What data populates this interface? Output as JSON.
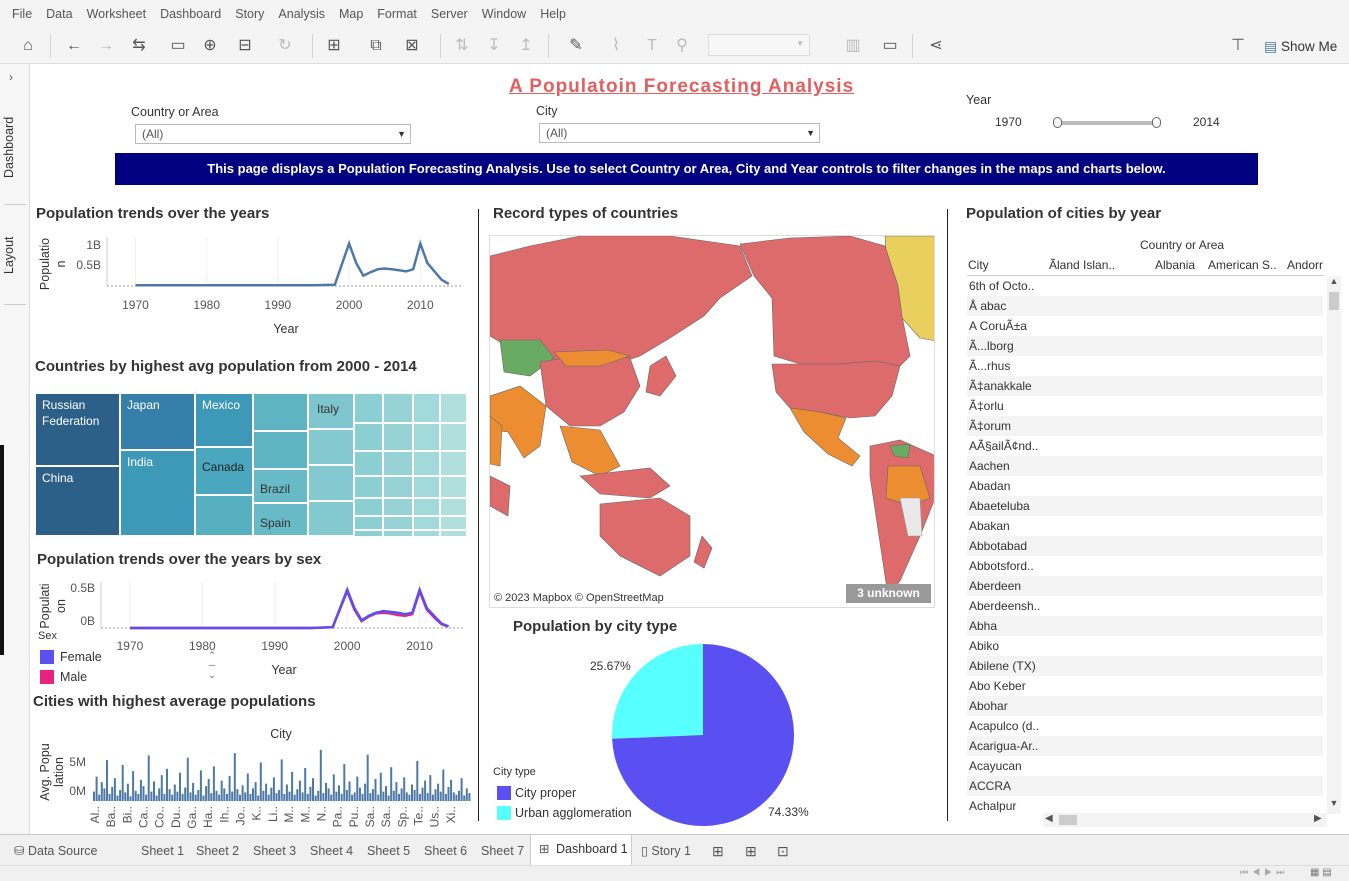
{
  "menu": [
    "File",
    "Data",
    "Worksheet",
    "Dashboard",
    "Story",
    "Analysis",
    "Map",
    "Format",
    "Server",
    "Window",
    "Help"
  ],
  "toolbar": {
    "show_me": "Show Me"
  },
  "left_rail": {
    "dashboard": "Dashboard",
    "layout": "Layout"
  },
  "dashboard": {
    "title": "A Populatoin Forecasting Analysis",
    "filters": {
      "country_label": "Country or Area",
      "country_value": "(All)",
      "city_label": "City",
      "city_value": "(All)",
      "year_label": "Year",
      "year_min": "1970",
      "year_max": "2014"
    },
    "banner": "This page displays a Population Forecasting Analysis. Use to select Country or Area, City and Year controls to filter changes in the maps and charts below."
  },
  "colors": {
    "banner_bg": "#000080",
    "title": "#e25f5f",
    "line": "#4e79a7",
    "female": "#5a4ff0",
    "male": "#e8237d",
    "city_proper": "#5a4ff0",
    "urban_agglomeration": "#57ffff"
  },
  "trend": {
    "title": "Population trends over the years",
    "ylabel_1": "Populatio",
    "ylabel_2": "n",
    "xlabel": "Year",
    "y_ticks": [
      "1B",
      "0.5B"
    ],
    "x_ticks": [
      "1970",
      "1980",
      "1990",
      "2000",
      "2010"
    ]
  },
  "treemap": {
    "title": "Countries by highest avg population from 2000 - 2014",
    "labels": {
      "russia_1": "Russian",
      "russia_2": "Federation",
      "japan": "Japan",
      "mexico": "Mexico",
      "italy": "Italy",
      "china": "China",
      "india": "India",
      "canada": "Canada",
      "brazil": "Brazil",
      "spain": "Spain"
    }
  },
  "sex_trend": {
    "title": "Population trends over the years by sex",
    "ylabel_1": "Populati",
    "ylabel_2": "on",
    "xlabel": "Year",
    "y_ticks": [
      "0.5B",
      "0B"
    ],
    "x_ticks": [
      "1970",
      "1980",
      "1990",
      "2000",
      "2010"
    ],
    "legend_title": "Sex",
    "legend": [
      "Female",
      "Male"
    ]
  },
  "top_cities": {
    "title": "Cities with highest average populations",
    "xlabel": "City",
    "ylabel_1": "Avg. Popu",
    "ylabel_2": "lation",
    "y_ticks": [
      "5M",
      "0M"
    ],
    "x_ticks": [
      "Al..",
      "Ba..",
      "Bi..",
      "Ca..",
      "Co..",
      "Du..",
      "Ga..",
      "Ha..",
      "Ih..",
      "Jo..",
      "K..",
      "Li..",
      "M..",
      "M..",
      "N..",
      "Pa..",
      "Pu..",
      "Sa..",
      "Sa..",
      "Sp..",
      "Te..",
      "Us..",
      "Xi.."
    ]
  },
  "map": {
    "title": "Record types of countries",
    "attribution": "© 2023 Mapbox © OpenStreetMap",
    "unknown": "3 unknown"
  },
  "pie": {
    "title": "Population by city type",
    "legend_title": "City type",
    "legend": [
      "City proper",
      "Urban agglomeration"
    ],
    "label_small": "25.67%",
    "label_large": "74.33%"
  },
  "cities_table": {
    "title": "Population of cities by year",
    "col_group": "Country or Area",
    "row_header": "City",
    "columns": [
      "Ãland Islan..",
      "Albania",
      "American S..",
      "Andorr"
    ],
    "rows": [
      "6th of Octo..",
      "Å abac",
      "A CoruÃ±a",
      "Ã...lborg",
      "Ã...rhus",
      "Ã‡anakkale",
      "Ã‡orlu",
      "Ã‡orum",
      "AÃ§ailÃ¢nd..",
      "Aachen",
      "Abadan",
      "Abaeteluba",
      "Abakan",
      "Abbotabad",
      "Abbotsford..",
      "Aberdeen",
      "Aberdeensh..",
      "Abha",
      "Abiko",
      "Abilene (TX)",
      "Abo Keber",
      "Abohar",
      "Acapulco (d..",
      "Acarigua-Ar..",
      "Acayucan",
      "ACCRA",
      "Achalpur"
    ]
  },
  "chart_data": [
    {
      "type": "line",
      "title": "Population trends over the years",
      "xlabel": "Year",
      "ylabel": "Population",
      "x": [
        1970,
        1975,
        1980,
        1985,
        1990,
        1995,
        1998,
        2000,
        2001,
        2002,
        2003,
        2004,
        2005,
        2006,
        2007,
        2008,
        2009,
        2010,
        2011,
        2012,
        2013,
        2014
      ],
      "values": [
        0.02,
        0.02,
        0.02,
        0.02,
        0.02,
        0.02,
        0.03,
        1.02,
        0.55,
        0.25,
        0.33,
        0.4,
        0.42,
        0.4,
        0.38,
        0.35,
        0.4,
        1.02,
        0.55,
        0.35,
        0.15,
        0.05
      ],
      "yunit": "B",
      "ylim": [
        0,
        1.2
      ]
    },
    {
      "type": "line",
      "title": "Population trends over the years by sex",
      "xlabel": "Year",
      "ylabel": "Population",
      "x": [
        1970,
        1975,
        1980,
        1985,
        1990,
        1995,
        1998,
        2000,
        2001,
        2002,
        2003,
        2004,
        2005,
        2006,
        2007,
        2008,
        2009,
        2010,
        2011,
        2012,
        2013,
        2014
      ],
      "series": [
        {
          "name": "Female",
          "values": [
            0.0,
            0.0,
            0.0,
            0.0,
            0.0,
            0.0,
            0.01,
            0.5,
            0.26,
            0.1,
            0.16,
            0.2,
            0.22,
            0.21,
            0.2,
            0.18,
            0.2,
            0.5,
            0.26,
            0.16,
            0.06,
            0.02
          ]
        },
        {
          "name": "Male",
          "values": [
            0.0,
            0.0,
            0.0,
            0.0,
            0.0,
            0.0,
            0.01,
            0.48,
            0.24,
            0.09,
            0.15,
            0.19,
            0.2,
            0.19,
            0.17,
            0.16,
            0.18,
            0.48,
            0.24,
            0.14,
            0.05,
            0.02
          ]
        }
      ],
      "yunit": "B",
      "ylim": [
        0,
        0.6
      ]
    },
    {
      "type": "pie",
      "title": "Population by city type",
      "categories": [
        "City proper",
        "Urban agglomeration"
      ],
      "values": [
        74.33,
        25.67
      ]
    },
    {
      "type": "bar",
      "title": "Cities with highest average populations",
      "xlabel": "City",
      "ylabel": "Avg. Population",
      "yunit": "M",
      "ylim": [
        0,
        7
      ],
      "values": [
        1.2,
        3.1,
        0.8,
        2.4,
        1.6,
        5.2,
        0.9,
        1.8,
        2.9,
        0.7,
        1.4,
        4.6,
        1.1,
        2.2,
        0.6,
        3.8,
        1.3,
        0.9,
        2.7,
        1.9,
        0.8,
        5.8,
        1.2,
        2.5,
        0.7,
        1.6,
        3.3,
        0.9,
        4.1,
        1.5,
        0.8,
        2.1,
        1.2,
        3.6,
        0.9,
        1.7,
        5.5,
        1.1,
        2.3,
        0.8,
        1.4,
        3.9,
        0.7,
        1.9,
        2.8,
        1.0,
        4.4,
        1.3,
        0.8,
        2.6,
        1.6,
        0.9,
        3.2,
        1.2,
        6.1,
        1.5,
        0.8,
        2.0,
        1.1,
        3.5,
        0.9,
        1.6,
        2.4,
        0.7,
        4.9,
        1.3,
        2.2,
        0.8,
        1.7,
        3.0,
        1.0,
        1.4,
        5.3,
        0.9,
        2.1,
        1.2,
        3.7,
        0.8,
        1.5,
        2.6,
        1.1,
        4.2,
        0.9,
        1.8,
        2.9,
        0.7,
        1.3,
        6.5,
        1.0,
        2.3,
        1.6,
        0.8,
        3.4,
        1.2,
        2.0,
        0.9,
        4.7,
        1.4,
        2.5,
        0.8,
        1.1,
        3.1,
        1.7,
        0.9,
        2.2,
        5.9,
        1.0,
        1.5,
        2.8,
        0.8,
        3.6,
        1.2,
        1.9,
        0.7,
        4.3,
        1.3,
        2.4,
        0.9,
        1.6,
        3.0,
        1.1,
        0.8,
        2.1,
        1.4,
        5.1,
        0.9,
        1.7,
        2.6,
        1.0,
        3.3,
        0.8,
        1.5,
        2.2,
        1.2,
        4.0,
        0.9,
        1.8,
        2.7,
        1.1,
        0.8,
        1.3,
        2.9,
        0.7,
        1.6,
        1.0
      ]
    }
  ],
  "sheet_tabs": [
    "Data Source",
    "Sheet 1",
    "Sheet 2",
    "Sheet 3",
    "Sheet 4",
    "Sheet 5",
    "Sheet 6",
    "Sheet 7",
    "Dashboard 1",
    "Story 1"
  ]
}
